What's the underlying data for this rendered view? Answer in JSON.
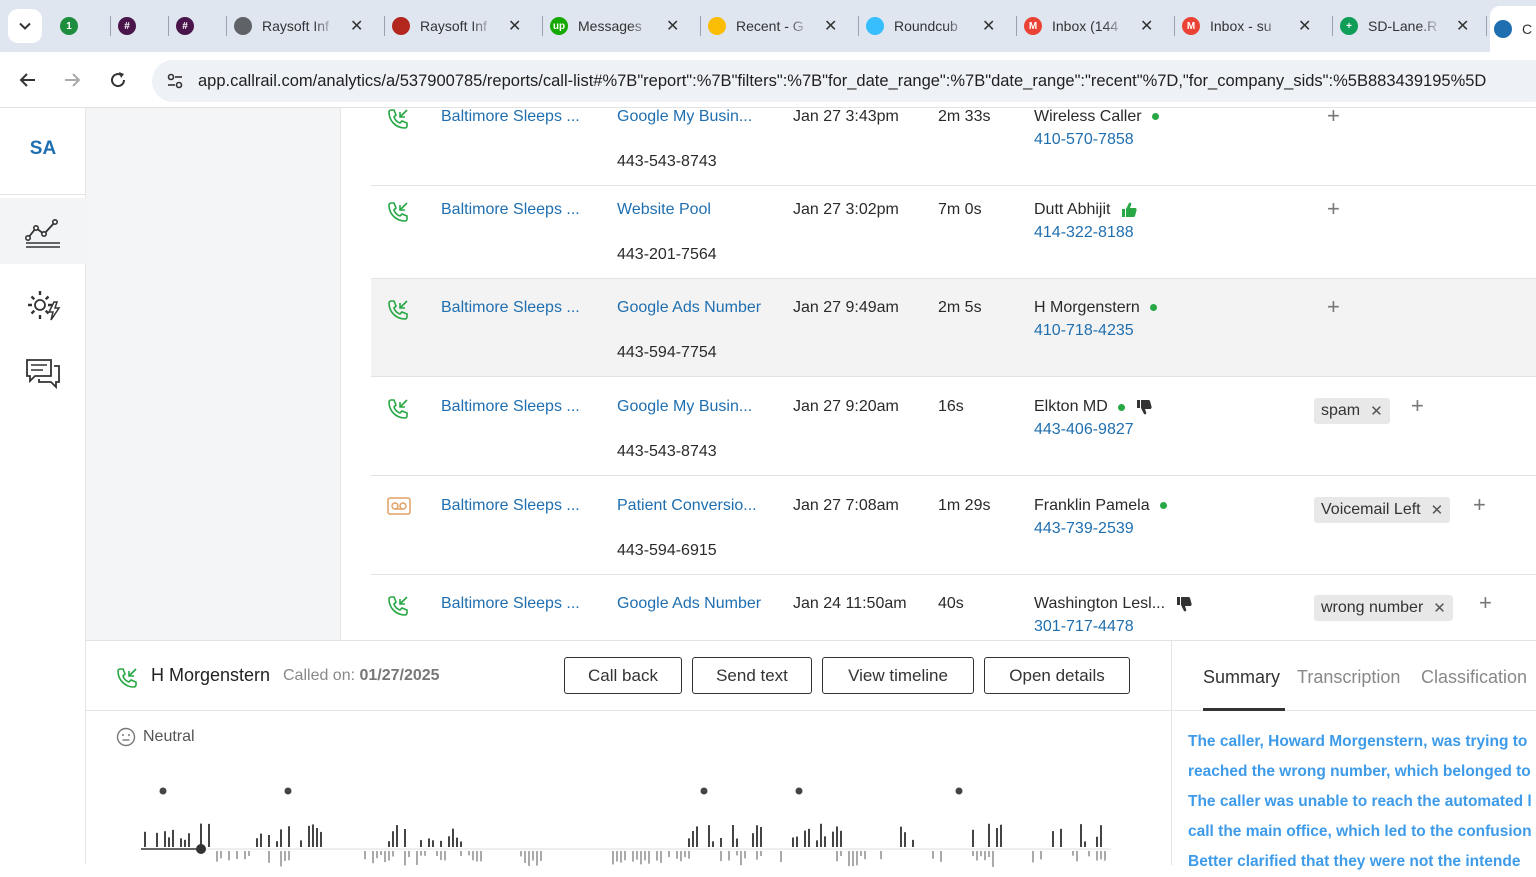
{
  "browser": {
    "tabs": [
      {
        "title": "",
        "fav_color": "#1e8e3e",
        "fav_text": "1"
      },
      {
        "title": "",
        "fav_color": "#4a154b",
        "fav_text": "#"
      },
      {
        "title": "",
        "fav_color": "#4a154b",
        "fav_text": "#"
      },
      {
        "title": "Raysoft Inf",
        "fav_color": "#5f6368",
        "fav_text": ""
      },
      {
        "title": "Raysoft Inf",
        "fav_color": "#b3261e",
        "fav_text": ""
      },
      {
        "title": "Messages",
        "fav_color": "#14a800",
        "fav_text": "up"
      },
      {
        "title": "Recent - G",
        "fav_color": "#fbbc04",
        "fav_text": ""
      },
      {
        "title": "Roundcub",
        "fav_color": "#37beff",
        "fav_text": ""
      },
      {
        "title": "Inbox (144",
        "fav_color": "#ea4335",
        "fav_text": "M"
      },
      {
        "title": "Inbox - su",
        "fav_color": "#ea4335",
        "fav_text": "M"
      },
      {
        "title": "SD-Lane.R",
        "fav_color": "#0f9d58",
        "fav_text": "+"
      },
      {
        "title": "C",
        "fav_color": "#1f6fb0",
        "fav_text": ""
      }
    ],
    "url": "app.callrail.com/analytics/a/537900785/reports/call-list#%7B\"report\":%7B\"filters\":%7B\"for_date_range\":%7B\"date_range\":\"recent\"%7D,\"for_company_sids\":%5B883439195%5D"
  },
  "sidebar": {
    "logo": "SA",
    "items": [
      {
        "name": "analytics-icon"
      },
      {
        "name": "settings-bolt-icon"
      },
      {
        "name": "messages-icon"
      }
    ]
  },
  "calls": [
    {
      "type": "inbound",
      "company": "Baltimore Sleeps ...",
      "source": "Google My Busin...",
      "tracking": "443-543-8743",
      "date": "Jan 27 3:43pm",
      "duration": "2m 33s",
      "caller": "Wireless Caller",
      "caller_phone": "410-570-7858",
      "mark": "dot",
      "tags": []
    },
    {
      "type": "inbound",
      "company": "Baltimore Sleeps ...",
      "source": "Website Pool",
      "tracking": "443-201-7564",
      "date": "Jan 27 3:02pm",
      "duration": "7m 0s",
      "caller": "Dutt Abhijit",
      "caller_phone": "414-322-8188",
      "mark": "thumbs-up",
      "tags": []
    },
    {
      "type": "inbound",
      "company": "Baltimore Sleeps ...",
      "source": "Google Ads Number",
      "tracking": "443-594-7754",
      "date": "Jan 27 9:49am",
      "duration": "2m 5s",
      "caller": "H Morgenstern",
      "caller_phone": "410-718-4235",
      "mark": "dot",
      "tags": []
    },
    {
      "type": "inbound",
      "company": "Baltimore Sleeps ...",
      "source": "Google My Busin...",
      "tracking": "443-543-8743",
      "date": "Jan 27 9:20am",
      "duration": "16s",
      "caller": "Elkton MD",
      "caller_phone": "443-406-9827",
      "mark": "dot-thumbs-down",
      "tags": [
        "spam"
      ]
    },
    {
      "type": "voicemail",
      "company": "Baltimore Sleeps ...",
      "source": "Patient Conversio...",
      "tracking": "443-594-6915",
      "date": "Jan 27 7:08am",
      "duration": "1m 29s",
      "caller": "Franklin Pamela",
      "caller_phone": "443-739-2539",
      "mark": "dot",
      "tags": [
        "Voicemail Left"
      ]
    },
    {
      "type": "inbound",
      "company": "Baltimore Sleeps ...",
      "source": "Google Ads Number",
      "tracking": "",
      "date": "Jan 24 11:50am",
      "duration": "40s",
      "caller": "Washington Lesl...",
      "caller_phone": "301-717-4478",
      "mark": "thumbs-down",
      "tags": [
        "wrong number"
      ]
    }
  ],
  "detail": {
    "caller": "H Morgenstern",
    "called_on_label": "Called on:",
    "called_on_date": "01/27/2025",
    "buttons": {
      "call_back": "Call back",
      "send_text": "Send text",
      "view_timeline": "View timeline",
      "open_details": "Open details"
    },
    "sentiment": "Neutral",
    "tabs": {
      "summary": "Summary",
      "transcription": "Transcription",
      "classification": "Classification"
    },
    "summary_lines": [
      "The caller, Howard Morgenstern, was trying to",
      "reached the wrong number, which belonged to",
      "The caller was unable to reach the automated l",
      "call the main office, which led to the confusion",
      "Better clarified that they were not the intende"
    ]
  },
  "colors": {
    "brand": "#1f6fb0",
    "green": "#27a844",
    "summary_text": "#3d9be9"
  }
}
